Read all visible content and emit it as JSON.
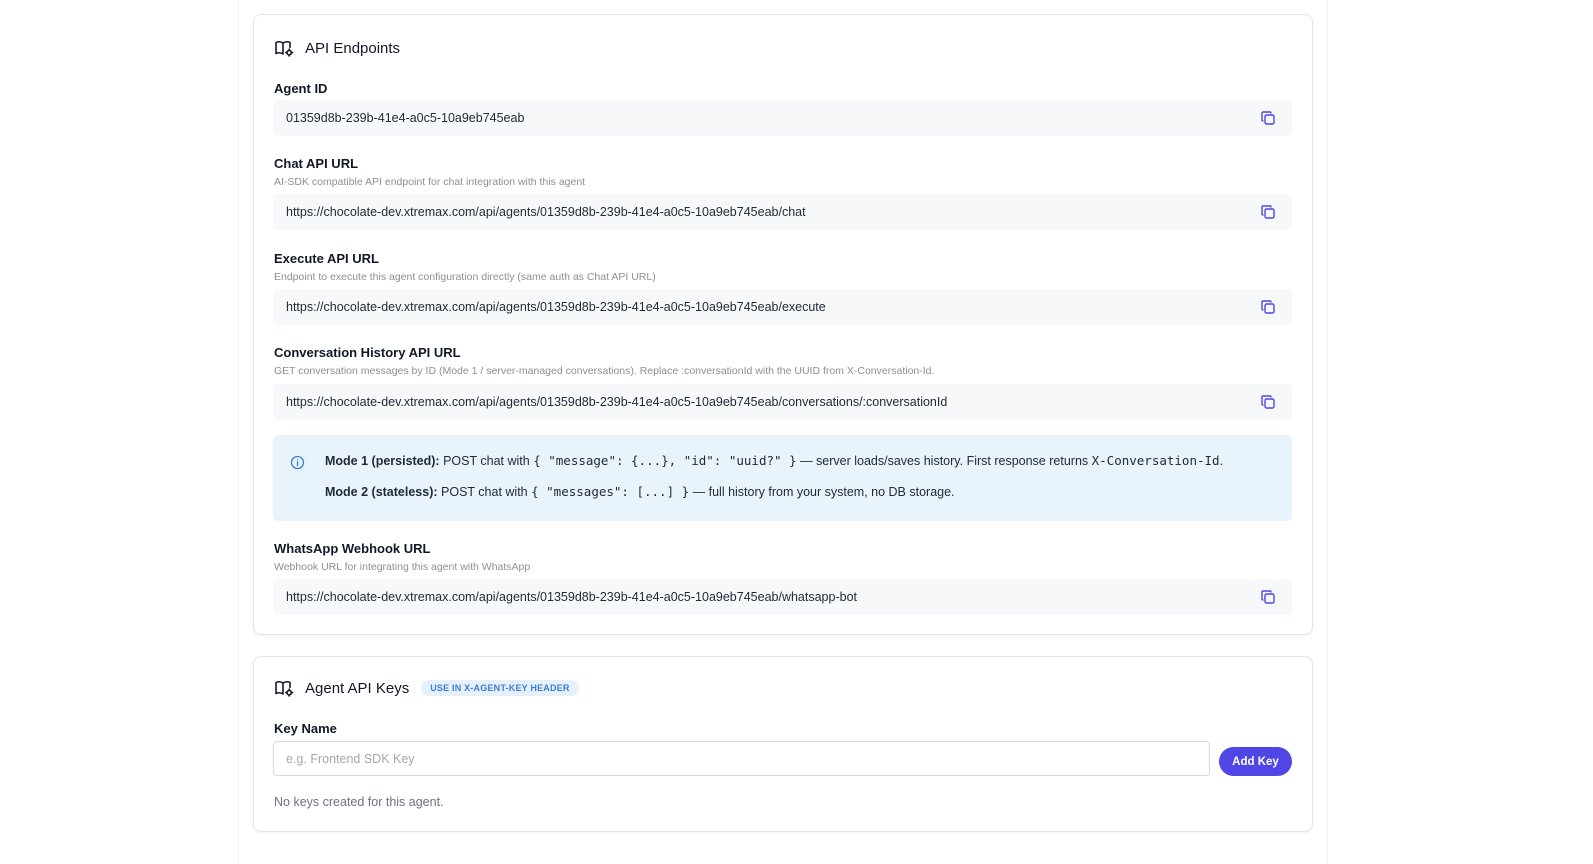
{
  "endpoints": {
    "title": "API Endpoints",
    "icon": "book-gear-icon",
    "agent_id": {
      "label": "Agent ID",
      "value": "01359d8b-239b-41e4-a0c5-10a9eb745eab"
    },
    "chat": {
      "label": "Chat API URL",
      "description": "AI-SDK compatible API endpoint for chat integration with this agent",
      "value": "https://chocolate-dev.xtremax.com/api/agents/01359d8b-239b-41e4-a0c5-10a9eb745eab/chat"
    },
    "execute": {
      "label": "Execute API URL",
      "description": "Endpoint to execute this agent configuration directly (same auth as Chat API URL)",
      "value": "https://chocolate-dev.xtremax.com/api/agents/01359d8b-239b-41e4-a0c5-10a9eb745eab/execute"
    },
    "history": {
      "label": "Conversation History API URL",
      "description": "GET conversation messages by ID (Mode 1 / server-managed conversations). Replace :conversationId with the UUID from X-Conversation-Id.",
      "value": "https://chocolate-dev.xtremax.com/api/agents/01359d8b-239b-41e4-a0c5-10a9eb745eab/conversations/:conversationId"
    },
    "info": {
      "icon": "info-circle-icon",
      "mode1": {
        "title": "Mode 1 (persisted):",
        "prefix": "POST chat with",
        "code": "{ \"message\": {...}, \"id\": \"uuid?\" }",
        "suffix": "— server loads/saves history. First response returns",
        "header_code": "X-Conversation-Id",
        "end": "."
      },
      "mode2": {
        "title": "Mode 2 (stateless):",
        "prefix": "POST chat with",
        "code": "{ \"messages\": [...] }",
        "suffix": "— full history from your system, no DB storage."
      }
    },
    "whatsapp": {
      "label": "WhatsApp Webhook URL",
      "description": "Webhook URL for integrating this agent with WhatsApp",
      "value": "https://chocolate-dev.xtremax.com/api/agents/01359d8b-239b-41e4-a0c5-10a9eb745eab/whatsapp-bot"
    },
    "copy_icon": "copy-icon"
  },
  "keys": {
    "title": "Agent API Keys",
    "badge": "USE IN X-AGENT-KEY HEADER",
    "key_name_label": "Key Name",
    "key_name_placeholder": "e.g. Frontend SDK Key",
    "add_button": "Add Key",
    "empty_message": "No keys created for this agent."
  },
  "colors": {
    "accent": "#4f46e5",
    "info_bg": "#e9f3fc",
    "badge_text": "#3b7dd8"
  }
}
